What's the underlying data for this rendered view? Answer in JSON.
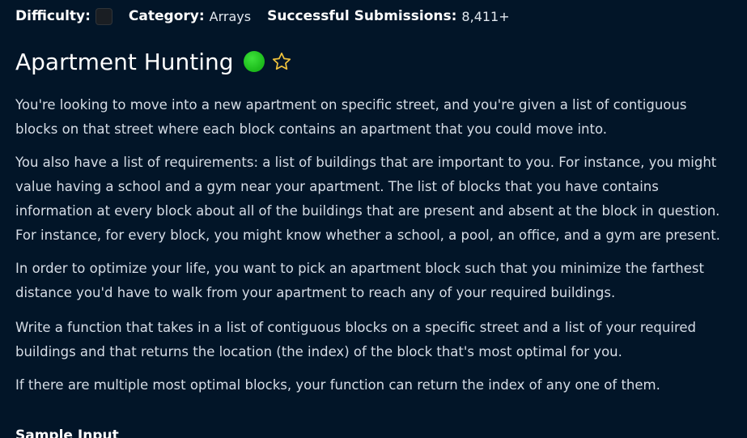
{
  "meta": {
    "difficulty_label": "Difficulty:",
    "category_label": "Category:",
    "category_value": "Arrays",
    "submissions_label": "Successful Submissions:",
    "submissions_value": "8,411+"
  },
  "problem": {
    "title": "Apartment Hunting",
    "status_color": "#22c521",
    "star_color": "#f0c33c",
    "paragraphs": [
      "You're looking to move into a new apartment on specific street, and you're given a list of contiguous blocks on that street where each block contains an apartment that you could move into.",
      "You also have a list of requirements: a list of buildings that are important to you. For instance, you might value having a school and a gym near your apartment. The list of blocks that you have contains information at every block about all of the buildings that are present and absent at the block in question. For instance, for every block, you might know whether a school, a pool, an office, and a gym are present.",
      "In order to optimize your life, you want to pick an apartment block such that you minimize the farthest distance you'd have to walk from your apartment to reach any of your required buildings.",
      "Write a function that takes in a list of contiguous blocks on a specific street and a list of your required buildings and that returns the location (the index) of the block that's most optimal for you.",
      "If there are multiple most optimal blocks, your function can return the index of any one of them."
    ],
    "sample_input_heading": "Sample Input"
  }
}
